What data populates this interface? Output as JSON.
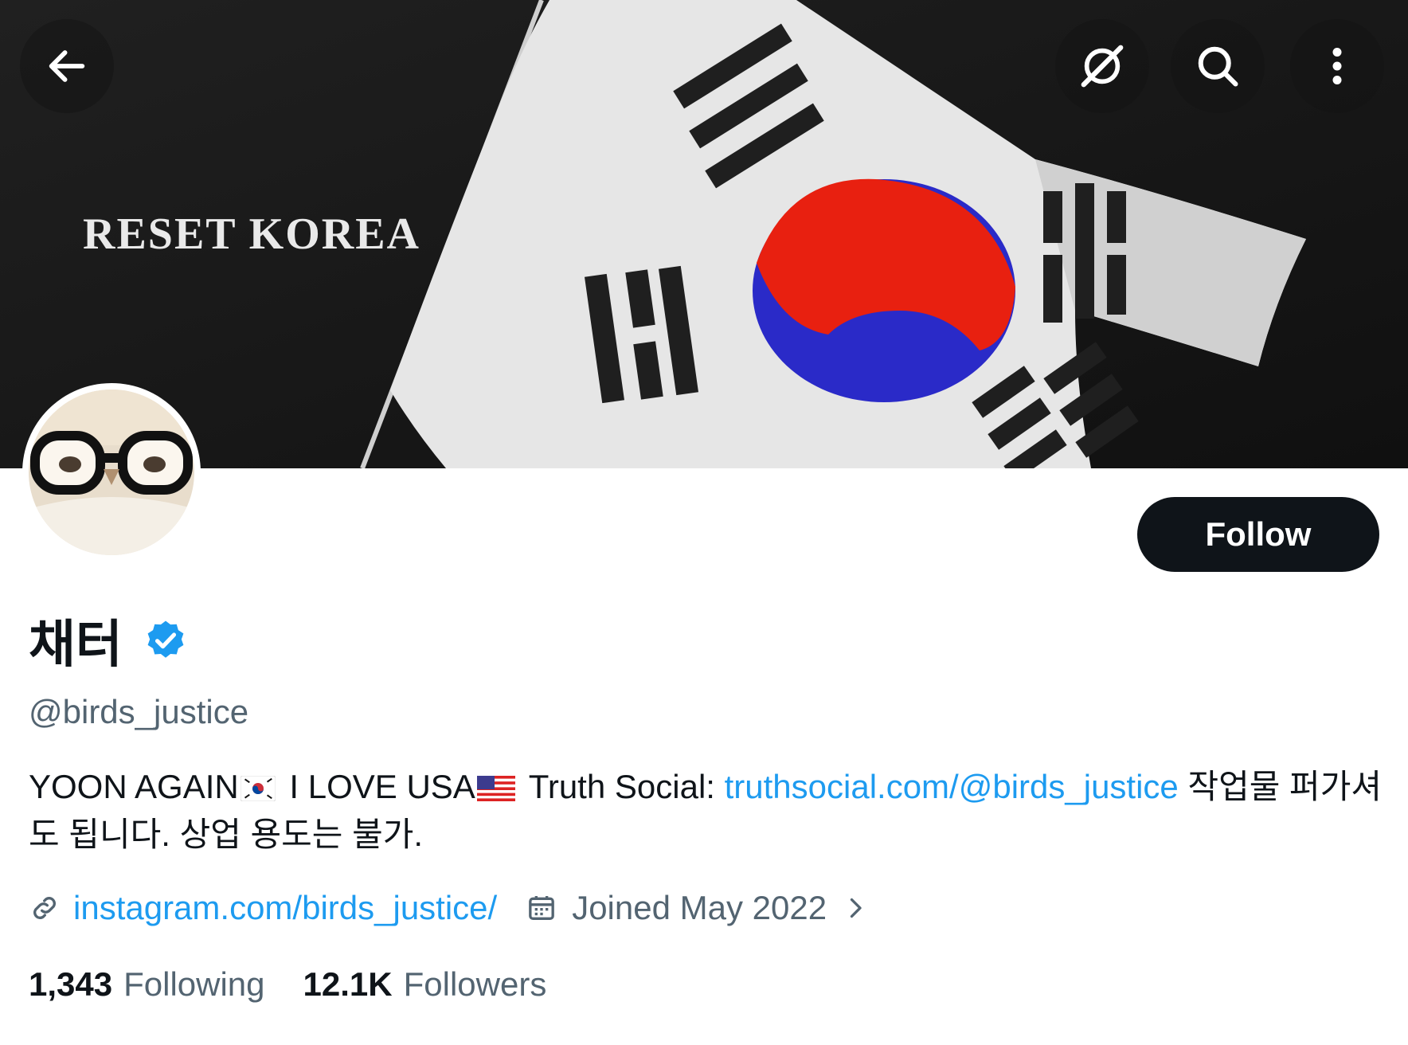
{
  "banner": {
    "text": "RESET KOREA"
  },
  "header_buttons": {
    "back": "arrow-left-icon",
    "grok": "grok-icon",
    "search": "search-icon",
    "more": "more-vertical-icon"
  },
  "profile": {
    "display_name": "채터",
    "handle": "@birds_justice",
    "verified": true,
    "follow_label": "Follow",
    "bio": {
      "part1": "YOON AGAIN",
      "part2": " I LOVE USA",
      "part3": " Truth Social: ",
      "link": "truthsocial.com/@birds_justice",
      "part4": " 작업물 퍼가셔도 됩니다. 상업 용도는 불가."
    },
    "website": "instagram.com/birds_justice/",
    "joined": "Joined May 2022",
    "following_count": "1,343",
    "following_label": "Following",
    "followers_count": "12.1K",
    "followers_label": "Followers"
  },
  "colors": {
    "accent": "#1d9bf0",
    "text": "#0f1419",
    "secondary": "#536471",
    "button": "#0f1419"
  }
}
